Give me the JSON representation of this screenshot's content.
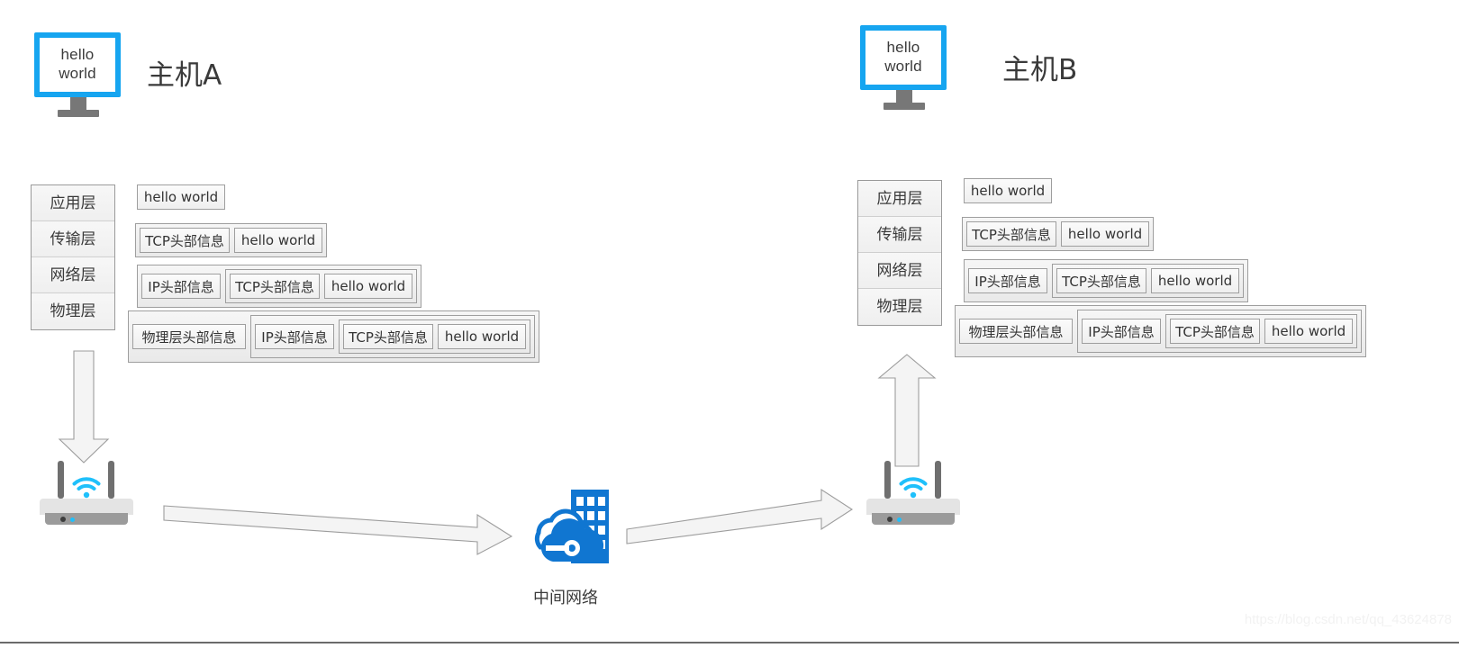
{
  "hosts": [
    {
      "id": "a",
      "label": "主机A",
      "screen_line1": "hello",
      "screen_line2": "world"
    },
    {
      "id": "b",
      "label": "主机B",
      "screen_line1": "hello",
      "screen_line2": "world"
    }
  ],
  "layers": {
    "application": "应用层",
    "transport": "传输层",
    "network": "网络层",
    "physical": "物理层"
  },
  "packet_labels": {
    "payload": "hello world",
    "tcp_header": "TCP头部信息",
    "ip_header": "IP头部信息",
    "physical_header": "物理层头部信息"
  },
  "middle_network": {
    "label": "中间网络"
  },
  "devices": {
    "router_a": "wifi-router-icon",
    "router_b": "wifi-router-icon",
    "cloud": "cloud-datacenter-icon"
  },
  "colors": {
    "monitor_accent": "#16a5f0",
    "wifi_accent": "#1fc0fb",
    "cloud_blue": "#1076d1",
    "box_fill": "#f2f2f2",
    "box_border": "#9e9e9e",
    "arrow_fill": "#f4f4f4",
    "arrow_border": "#9d9d9d"
  },
  "watermark": "https://blog.csdn.net/qq_43624878"
}
